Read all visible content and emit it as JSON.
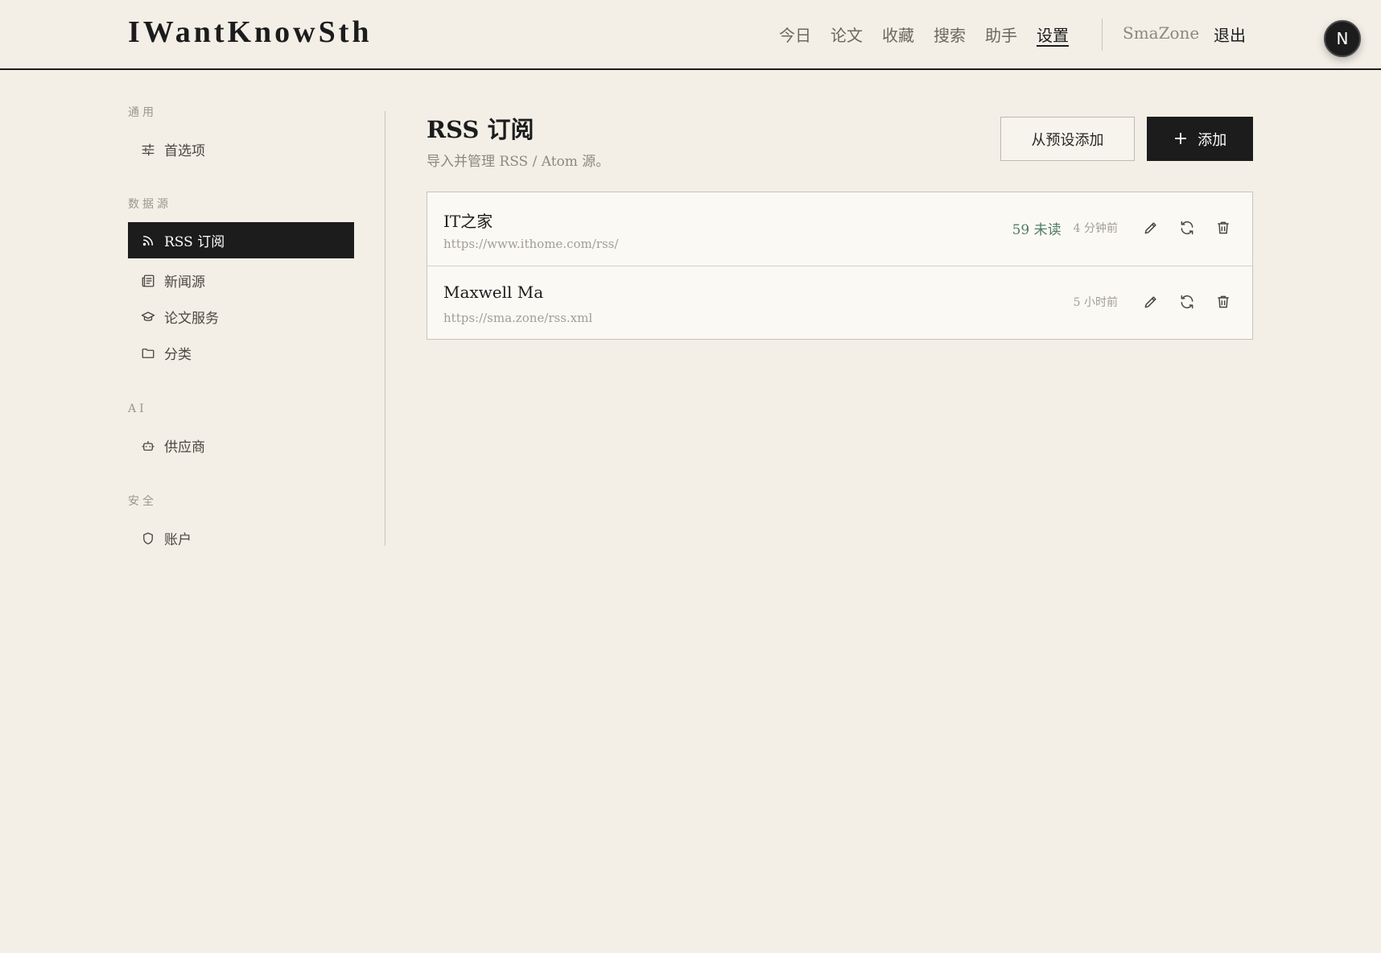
{
  "app": {
    "logo": "IWantKnowSth"
  },
  "nav": {
    "items": [
      {
        "label": "今日"
      },
      {
        "label": "论文"
      },
      {
        "label": "收藏"
      },
      {
        "label": "搜索"
      },
      {
        "label": "助手"
      },
      {
        "label": "设置",
        "active": true
      }
    ],
    "user": "SmaZone",
    "logout": "退出",
    "avatar_letter": "N"
  },
  "sidebar": {
    "sections": [
      {
        "label": "通用",
        "items": [
          {
            "label": "首选项",
            "icon": "sliders-icon"
          }
        ]
      },
      {
        "label": "数据源",
        "items": [
          {
            "label": "RSS 订阅",
            "icon": "rss-icon",
            "active": true
          },
          {
            "label": "新闻源",
            "icon": "newspaper-icon"
          },
          {
            "label": "论文服务",
            "icon": "graduation-cap-icon"
          },
          {
            "label": "分类",
            "icon": "folder-icon"
          }
        ]
      },
      {
        "label": "AI",
        "items": [
          {
            "label": "供应商",
            "icon": "bot-icon"
          }
        ]
      },
      {
        "label": "安全",
        "items": [
          {
            "label": "账户",
            "icon": "shield-icon"
          }
        ]
      }
    ]
  },
  "main": {
    "title": "RSS 订阅",
    "subtitle": "导入并管理 RSS / Atom 源。",
    "preset_button": "从预设添加",
    "add_button": "添加",
    "feeds": [
      {
        "name": "IT之家",
        "url": "https://www.ithome.com/rss/",
        "unread": "59 未读",
        "time": "4 分钟前"
      },
      {
        "name": "Maxwell Ma",
        "url": "https://sma.zone/rss.xml",
        "unread": "",
        "time": "5 小时前"
      }
    ]
  },
  "colors": {
    "background": "#f3efe7",
    "ink": "#1c1c1c",
    "unread": "#4f7a6b"
  }
}
